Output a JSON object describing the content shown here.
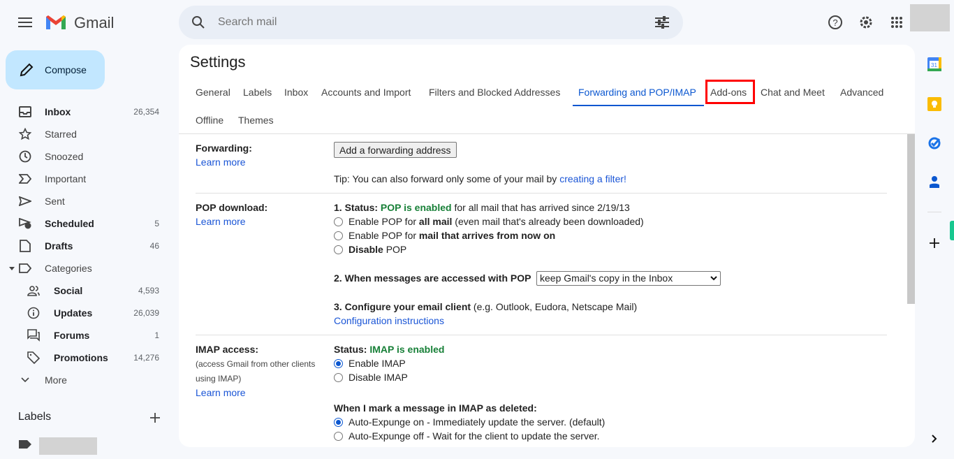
{
  "app": {
    "name": "Gmail"
  },
  "search": {
    "placeholder": "Search mail"
  },
  "compose_label": "Compose",
  "sidebar": {
    "items": [
      {
        "label": "Inbox",
        "count": "26,354",
        "icon": "inbox-icon",
        "bold": true
      },
      {
        "label": "Starred",
        "count": "",
        "icon": "star-icon"
      },
      {
        "label": "Snoozed",
        "count": "",
        "icon": "clock-icon"
      },
      {
        "label": "Important",
        "count": "",
        "icon": "important-icon"
      },
      {
        "label": "Sent",
        "count": "",
        "icon": "send-icon"
      },
      {
        "label": "Scheduled",
        "count": "5",
        "icon": "scheduled-send-icon",
        "bold": true
      },
      {
        "label": "Drafts",
        "count": "46",
        "icon": "draft-icon",
        "bold": true
      },
      {
        "label": "Categories",
        "count": "",
        "icon": "label-icon"
      },
      {
        "label": "Social",
        "count": "4,593",
        "icon": "people-icon",
        "bold": true
      },
      {
        "label": "Updates",
        "count": "26,039",
        "icon": "info-icon",
        "bold": true
      },
      {
        "label": "Forums",
        "count": "1",
        "icon": "forum-icon",
        "bold": true
      },
      {
        "label": "Promotions",
        "count": "14,276",
        "icon": "tag-icon",
        "bold": true
      },
      {
        "label": "More",
        "count": "",
        "icon": "chevron-down-icon"
      }
    ],
    "labels_heading": "Labels"
  },
  "settings": {
    "title": "Settings",
    "tabs": [
      "General",
      "Labels",
      "Inbox",
      "Accounts and Import",
      "Filters and Blocked Addresses",
      "Forwarding and POP/IMAP",
      "Add-ons",
      "Chat and Meet",
      "Advanced",
      "Offline",
      "Themes"
    ],
    "active_tab": "Forwarding and POP/IMAP",
    "highlight_color": "#ff0000",
    "accent": "#0b57d0"
  },
  "forwarding": {
    "label": "Forwarding:",
    "learn_more": "Learn more",
    "button": "Add a forwarding address",
    "tip": "Tip: You can also forward only some of your mail by ",
    "tip_link": "creating a filter!"
  },
  "pop": {
    "label": "POP download:",
    "learn_more": "Learn more",
    "status_prefix": "1. Status: ",
    "status": "POP is enabled",
    "status_suffix": " for all mail that has arrived since 2/19/13",
    "opt1_a": "Enable POP for ",
    "opt1_b": "all mail",
    "opt1_c": " (even mail that's already been downloaded)",
    "opt2_a": "Enable POP for ",
    "opt2_b": "mail that arrives from now on",
    "opt3_a": "Disable",
    "opt3_b": " POP",
    "access_label": "2. When messages are accessed with POP",
    "access_value": "keep Gmail's copy in the Inbox",
    "config_a": "3. Configure your email client",
    "config_b": " (e.g. Outlook, Eudora, Netscape Mail)",
    "config_link": "Configuration instructions"
  },
  "imap": {
    "label": "IMAP access:",
    "desc1": "(access Gmail from other clients",
    "desc2": "using IMAP)",
    "learn_more": "Learn more",
    "status_prefix": "Status: ",
    "status": "IMAP is enabled",
    "enable": "Enable IMAP",
    "disable": "Disable IMAP",
    "deleted_heading": "When I mark a message in IMAP as deleted:",
    "expunge_on": "Auto-Expunge on - Immediately update the server. (default)",
    "expunge_off": "Auto-Expunge off - Wait for the client to update the server."
  }
}
